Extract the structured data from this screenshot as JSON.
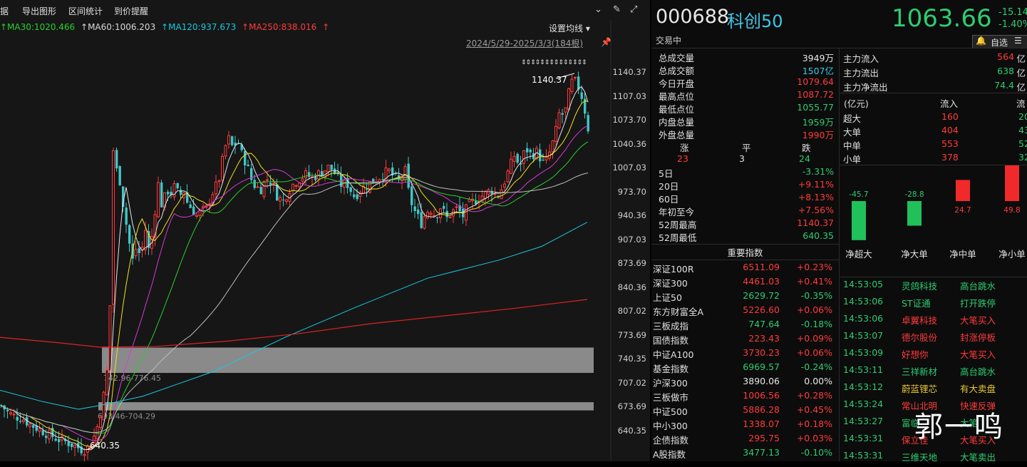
{
  "menu": {
    "items": [
      "据",
      "导出图形",
      "区间统计",
      "到价提醒"
    ],
    "icons": [
      "circle-chevron-down-icon",
      "pencil-icon",
      "expand-icon"
    ]
  },
  "legend": {
    "ma30": "↑MA30:1020.466",
    "ma60": "↑MA60:1006.203",
    "ma120": "↑MA120:937.673",
    "ma250": "↑MA250:838.016",
    "ma250_arrow": "↑",
    "adjust": "设置均线 ▾",
    "range": "2024/5/29-2025/3/3(184根)"
  },
  "colors": {
    "up": "#ff3b3b",
    "down": "#3fc7c7",
    "ma5": "#e6e6e6",
    "ma10": "#f2e21a",
    "ma20": "#d43ad6",
    "ma30": "#27d02b",
    "ma60": "#bdbdbd",
    "ma120": "#17c9e0",
    "ma250": "#e02222"
  },
  "y_axis": [
    "1140.37",
    "1107.03",
    "1073.70",
    "1040.36",
    "1007.03",
    "973.70",
    "940.36",
    "907.03",
    "873.69",
    "840.36",
    "807.02",
    "773.69",
    "740.35",
    "707.02",
    "673.69",
    "640.35"
  ],
  "annotations": {
    "high": "1140.37",
    "low": "640.35",
    "gap1": "742.96-776.45",
    "gap2": "693.46-704.29",
    "arrows": "⇕⇕⇕⇕⇕⇕⇕⇕⇕⇕⇕⇕⇕⇕"
  },
  "header": {
    "code": "000688",
    "name": "科创50",
    "price": "1063.66",
    "change": "-15.14",
    "change_pct": "-1.40%",
    "status": "交易中",
    "watch": "自选 -"
  },
  "stats": [
    {
      "label": "总成交量",
      "value": "3949万",
      "color": "white"
    },
    {
      "label": "总成交额",
      "value": "1507亿",
      "color": "cyan"
    },
    {
      "label": "今日开盘",
      "value": "1079.64",
      "color": "red"
    },
    {
      "label": "最高点位",
      "value": "1087.72",
      "color": "red"
    },
    {
      "label": "最低点位",
      "value": "1055.77",
      "color": "green"
    },
    {
      "label": "内盘总量",
      "value": "1959万",
      "color": "green"
    },
    {
      "label": "外盘总量",
      "value": "1990万",
      "color": "red"
    }
  ],
  "breadth": {
    "labels": [
      "涨",
      "平",
      "跌"
    ],
    "values": [
      "23",
      "3",
      "24"
    ]
  },
  "periods": [
    {
      "label": "5日",
      "value": "-3.31%",
      "color": "green"
    },
    {
      "label": "20日",
      "value": "+9.11%",
      "color": "red"
    },
    {
      "label": "60日",
      "value": "+8.13%",
      "color": "red"
    },
    {
      "label": "年初至今",
      "value": "+7.56%",
      "color": "red"
    },
    {
      "label": "52周最高",
      "value": "1140.37",
      "color": "red"
    },
    {
      "label": "52周最低",
      "value": "640.35",
      "color": "green"
    }
  ],
  "indices_title": "重要指数",
  "indices": [
    {
      "name": "深证100R",
      "price": "6511.09",
      "chg": "+0.23%",
      "color": "red"
    },
    {
      "name": "深证300",
      "price": "4461.03",
      "chg": "+0.41%",
      "color": "red"
    },
    {
      "name": "上证50",
      "price": "2629.72",
      "chg": "-0.35%",
      "color": "green"
    },
    {
      "name": "东方财富全A",
      "price": "5226.60",
      "chg": "+0.06%",
      "color": "red"
    },
    {
      "name": "三板成指",
      "price": "747.64",
      "chg": "-0.18%",
      "color": "green"
    },
    {
      "name": "国债指数",
      "price": "223.43",
      "chg": "+0.09%",
      "color": "red"
    },
    {
      "name": "中证A100",
      "price": "3730.23",
      "chg": "+0.06%",
      "color": "red"
    },
    {
      "name": "基金指数",
      "price": "6969.57",
      "chg": "-0.24%",
      "color": "green"
    },
    {
      "name": "沪深300",
      "price": "3890.06",
      "chg": "0.00%",
      "color": "white"
    },
    {
      "name": "三板做市",
      "price": "1006.56",
      "chg": "+0.28%",
      "color": "red"
    },
    {
      "name": "中证500",
      "price": "5886.28",
      "chg": "+0.45%",
      "color": "red"
    },
    {
      "name": "中小300",
      "price": "1338.07",
      "chg": "+0.18%",
      "color": "red"
    },
    {
      "name": "企债指数",
      "price": "295.75",
      "chg": "+0.03%",
      "color": "red"
    },
    {
      "name": "A股指数",
      "price": "3477.13",
      "chg": "-0.10%",
      "color": "green"
    }
  ],
  "capital_flow": {
    "inflow_label": "主力流入",
    "inflow": "564",
    "inflow_unit": "亿",
    "outflow_label": "主力流出",
    "outflow": "638",
    "outflow_unit": "亿",
    "net_label": "主力净流出",
    "net": "74.4",
    "net_unit": "亿",
    "table_unit": "(亿元)",
    "col_in": "流入",
    "col_out": "流",
    "rows": [
      {
        "label": "超大",
        "in": "160",
        "out": "20"
      },
      {
        "label": "大单",
        "in": "404",
        "out": "43"
      },
      {
        "label": "中单",
        "in": "553",
        "out": "52"
      },
      {
        "label": "小单",
        "in": "378",
        "out": "32"
      }
    ]
  },
  "chart_data": {
    "type": "bar",
    "categories": [
      "净超大",
      "净大单",
      "净中单",
      "净小单"
    ],
    "values": [
      -45.7,
      -28.8,
      24.7,
      49.8
    ],
    "value_labels": [
      "-45.7",
      "-28.8",
      "24.7",
      "49.8"
    ]
  },
  "ticker": [
    {
      "time": "14:53:05",
      "stock": "灵鸽科技",
      "event": "高台跳水",
      "sc": "green",
      "ec": "green"
    },
    {
      "time": "14:53:06",
      "stock": "ST证通",
      "event": "打开跌停",
      "sc": "green",
      "ec": "green"
    },
    {
      "time": "14:53:06",
      "stock": "卓翼科技",
      "event": "大笔买入",
      "sc": "red",
      "ec": "red"
    },
    {
      "time": "14:53:07",
      "stock": "德尔股份",
      "event": "封涨停板",
      "sc": "red",
      "ec": "red"
    },
    {
      "time": "14:53:09",
      "stock": "好想你",
      "event": "大笔买入",
      "sc": "red",
      "ec": "red"
    },
    {
      "time": "14:53:11",
      "stock": "三祥新材",
      "event": "高台跳水",
      "sc": "green",
      "ec": "green"
    },
    {
      "time": "14:53:12",
      "stock": "蔚蓝锂芯",
      "event": "有大卖盘",
      "sc": "yellow",
      "ec": "yellow"
    },
    {
      "time": "14:53:24",
      "stock": "常山北明",
      "event": "快速反弹",
      "sc": "red",
      "ec": "red"
    },
    {
      "time": "14:53:27",
      "stock": "富临",
      "event": "大笔",
      "sc": "green",
      "ec": "green"
    },
    {
      "time": "14:53:31",
      "stock": "保立佳",
      "event": "大笔买入",
      "sc": "red",
      "ec": "red"
    },
    {
      "time": "14:53:31",
      "stock": "三维天地",
      "event": "大笔卖出",
      "sc": "green",
      "ec": "green"
    }
  ],
  "watermark": "郭一鸣"
}
